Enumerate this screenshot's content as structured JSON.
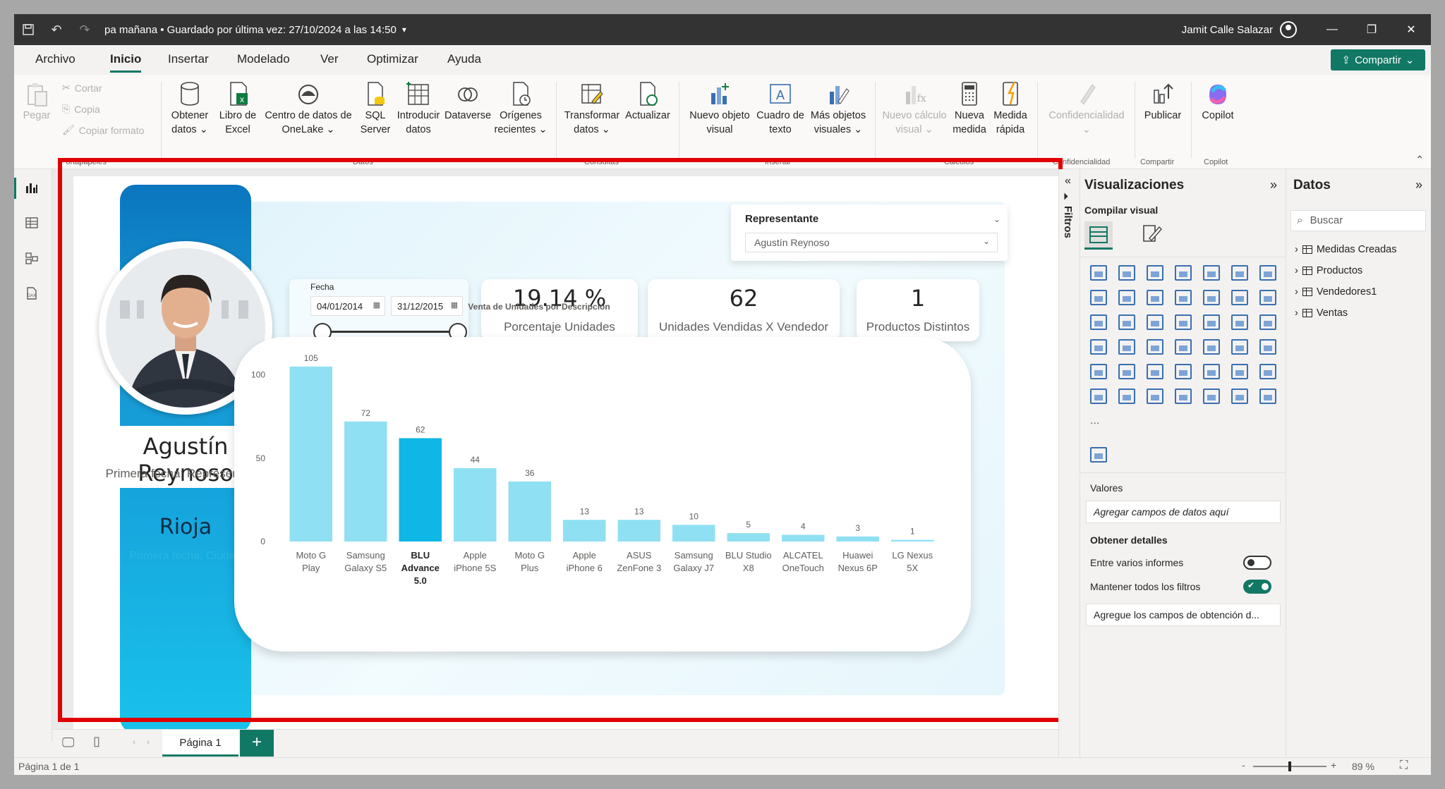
{
  "titlebar": {
    "doc_title": "pa mañana • Guardado por última vez: 27/10/2024 a las 14:50",
    "user_name": "Jamit Calle Salazar"
  },
  "menu": {
    "tabs": [
      "Archivo",
      "Inicio",
      "Insertar",
      "Modelado",
      "Ver",
      "Optimizar",
      "Ayuda"
    ],
    "active": "Inicio",
    "share_label": "Compartir"
  },
  "ribbon": {
    "paste": "Pegar",
    "cut": "Cortar",
    "copy": "Copia",
    "format_painter": "Copiar formato",
    "group_clipboard": "Portapapeles",
    "get_data": [
      "Obtener",
      "datos ⌄"
    ],
    "excel": [
      "Libro de",
      "Excel"
    ],
    "onelake": [
      "Centro de datos de",
      "OneLake ⌄"
    ],
    "sql": [
      "SQL",
      "Server"
    ],
    "enter_data": [
      "Introducir",
      "datos"
    ],
    "dataverse": "Dataverse",
    "recent": [
      "Orígenes",
      "recientes ⌄"
    ],
    "group_data": "Datos",
    "transform": [
      "Transformar",
      "datos ⌄"
    ],
    "refresh": "Actualizar",
    "group_queries": "Consultas",
    "new_visual": [
      "Nuevo objeto",
      "visual"
    ],
    "textbox": [
      "Cuadro de",
      "texto"
    ],
    "more_visuals": [
      "Más objetos",
      "visuales ⌄"
    ],
    "group_insert": "Insertar",
    "new_calc": [
      "Nuevo cálculo",
      "visual ⌄"
    ],
    "new_measure": [
      "Nueva",
      "medida"
    ],
    "quick_measure": [
      "Medida",
      "rápida"
    ],
    "group_calc": "Cálculos",
    "sensitivity": "Confidencialidad",
    "group_sensitivity": "Confidencialidad",
    "publish": "Publicar",
    "group_share": "Compartir",
    "copilot": "Copilot",
    "group_copilot": "Copilot"
  },
  "report": {
    "rep_name": "Agustín Reynoso",
    "rep_sub": "Primera fecha: Representante",
    "city": "Rioja",
    "city_sub": "Primera fecha: Ciudad",
    "slicer_rep_title": "Representante",
    "slicer_rep_value": "Agustín Reynoso",
    "date_title": "Fecha",
    "date_from": "04/01/2014",
    "date_to": "31/12/2015",
    "kpis": [
      {
        "value": "19.14 %",
        "label": "Porcentaje Unidades"
      },
      {
        "value": "62",
        "label": "Unidades Vendidas X Vendedor"
      },
      {
        "value": "1",
        "label": "Productos Distintos"
      }
    ]
  },
  "chart_data": {
    "type": "bar",
    "title": "Venta de Unidades por Descripción",
    "categories": [
      "Moto G Play",
      "Samsung Galaxy S5",
      "BLU Advance 5.0",
      "Apple iPhone 5S",
      "Moto G Plus",
      "Apple iPhone 6",
      "ASUS ZenFone 3",
      "Samsung Galaxy J7",
      "BLU Studio X8",
      "ALCATEL OneTouch",
      "Huawei Nexus 6P",
      "LG Nexus 5X"
    ],
    "category_lines": [
      [
        "Moto G",
        "Play"
      ],
      [
        "Samsung",
        "Galaxy S5"
      ],
      [
        "BLU",
        "Advance",
        "5.0"
      ],
      [
        "Apple",
        "iPhone 5S"
      ],
      [
        "Moto G",
        "Plus"
      ],
      [
        "Apple",
        "iPhone 6"
      ],
      [
        "ASUS",
        "ZenFone 3"
      ],
      [
        "Samsung",
        "Galaxy J7"
      ],
      [
        "BLU Studio",
        "X8"
      ],
      [
        "ALCATEL",
        "OneTouch"
      ],
      [
        "Huawei",
        "Nexus 6P"
      ],
      [
        "LG Nexus",
        "5X"
      ]
    ],
    "values": [
      105,
      72,
      62,
      44,
      36,
      13,
      13,
      10,
      5,
      4,
      3,
      1
    ],
    "highlighted": "BLU Advance 5.0",
    "yticks": [
      0,
      50,
      100
    ],
    "ylim": [
      0,
      110
    ],
    "colors": {
      "bar": "#8fe0f3",
      "highlight": "#0fb7e6"
    },
    "grid": false
  },
  "pages": {
    "tab": "Página 1",
    "status": "Página 1 de 1",
    "zoom": "89 %"
  },
  "filters_label": "Filtros",
  "viz_pane": {
    "title": "Visualizaciones",
    "build": "Compilar visual",
    "more": "...",
    "values_label": "Valores",
    "values_placeholder": "Agregar campos de datos aquí",
    "drill_label": "Obtener detalles",
    "cross_report": "Entre varios informes",
    "keep_filters": "Mantener todos los filtros",
    "drill_placeholder": "Agregue los campos de obtención d...",
    "cross_report_on": false,
    "keep_filters_on": true
  },
  "data_pane": {
    "title": "Datos",
    "search_placeholder": "Buscar",
    "tables": [
      "Medidas Creadas",
      "Productos",
      "Vendedores1",
      "Ventas"
    ]
  }
}
